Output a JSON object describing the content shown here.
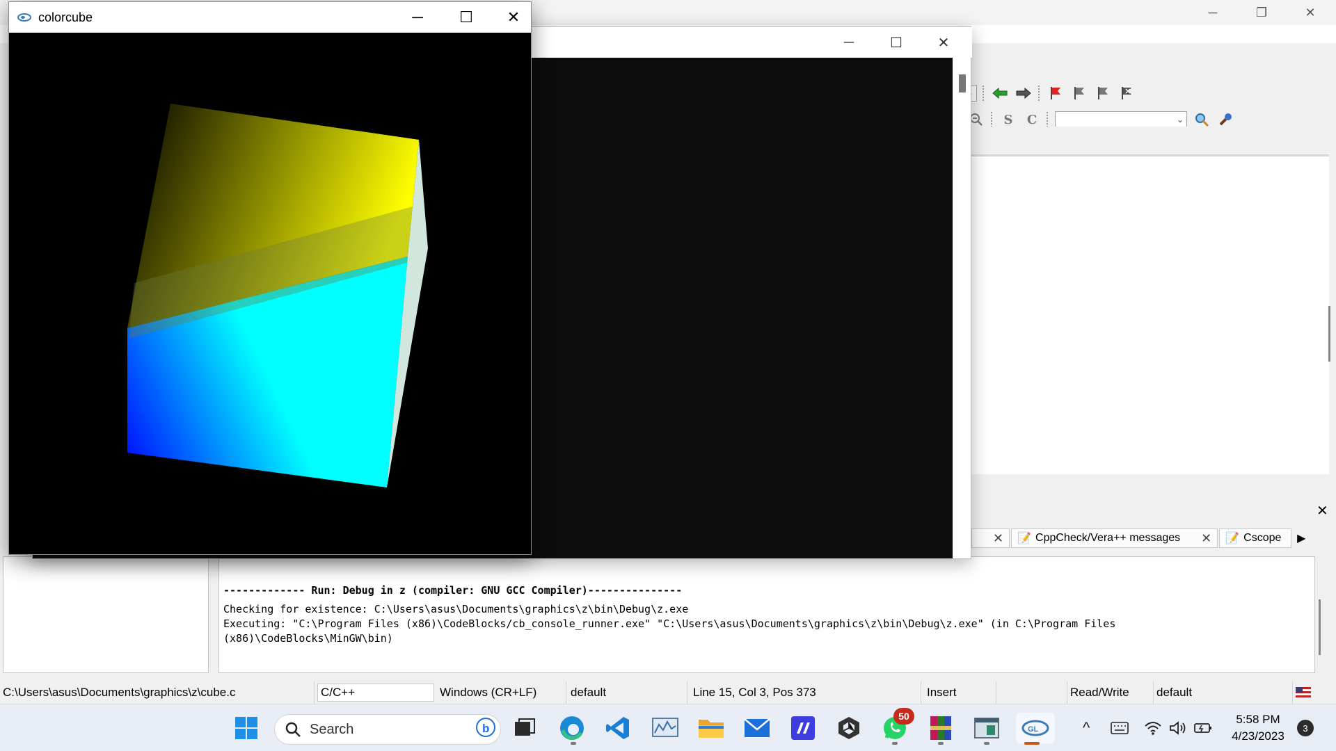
{
  "cube_window": {
    "title": "colorcube",
    "controls": {
      "minimize": "─",
      "maximize": "☐",
      "close": "✕"
    }
  },
  "console_window": {
    "controls": {
      "minimize": "─",
      "maximize": "☐",
      "close": "✕"
    }
  },
  "ide_window": {
    "controls": {
      "minimize": "─",
      "restore": "❐",
      "close": "✕"
    },
    "toolbar_icons": [
      "arrow-left-icon",
      "arrow-right-icon",
      "bookmark-toggle-icon",
      "bookmark-prev-icon",
      "bookmark-next-icon",
      "bookmark-clear-icon"
    ],
    "search_toolbar": {
      "s_label": "S",
      "c_label": "C"
    }
  },
  "logs": {
    "tabs": [
      {
        "label": "CppCheck/Vera++ messages"
      },
      {
        "label": "Cscope"
      }
    ],
    "lines": {
      "run_header": "------------- Run: Debug in z (compiler: GNU GCC Compiler)---------------",
      "checking": "Checking for existence: C:\\Users\\asus\\Documents\\graphics\\z\\bin\\Debug\\z.exe",
      "executing_1": "Executing: \"C:\\Program Files (x86)\\CodeBlocks/cb_console_runner.exe\" \"C:\\Users\\asus\\Documents\\graphics\\z\\bin\\Debug\\z.exe\"  (in C:\\Program Files",
      "executing_2": "(x86)\\CodeBlocks\\MinGW\\bin)"
    }
  },
  "statusbar": {
    "path": "C:\\Users\\asus\\Documents\\graphics\\z\\cube.c",
    "language": "C/C++",
    "line_endings": "Windows (CR+LF)",
    "encoding": "default",
    "position": "Line 15, Col 3, Pos 373",
    "mode": "Insert",
    "access": "Read/Write",
    "profile": "default"
  },
  "taskbar": {
    "search_placeholder": "Search",
    "whatsapp_badge": "50",
    "clock_time": "5:58 PM",
    "clock_date": "4/23/2023",
    "notifications": "3",
    "tray_overflow": "^"
  },
  "colors": {
    "cube_yellow": "#ffff00",
    "cube_cyan": "#00ffff",
    "cube_blue": "#0000ff",
    "taskbar_bg": "#e9eef6",
    "badge_red": "#c42b1c"
  }
}
